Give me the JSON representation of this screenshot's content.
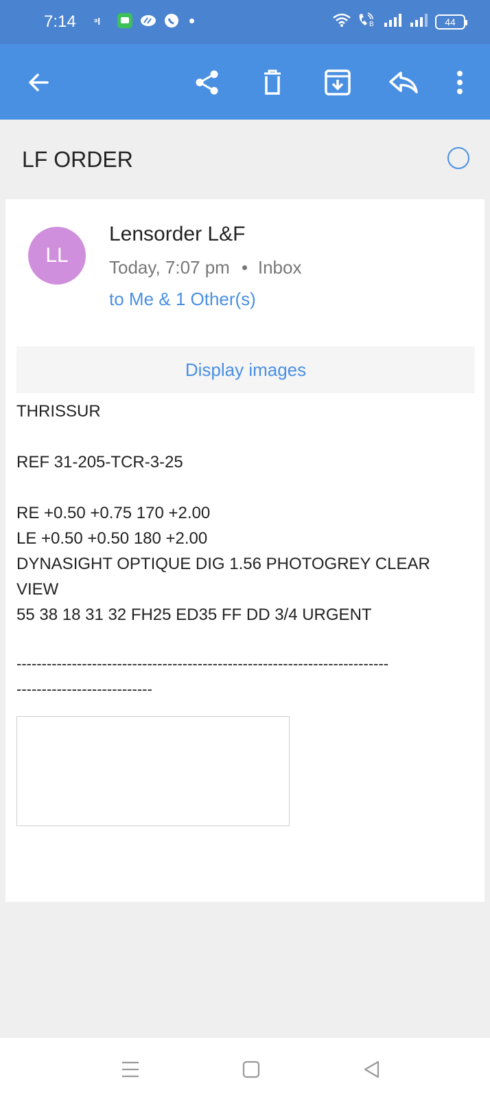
{
  "status_bar": {
    "time": "7:14",
    "battery": "44",
    "left_icons": [
      "signal-alert-icon",
      "message-app-icon",
      "loop-app-icon",
      "whatsapp-icon",
      "more-notifications-dot-icon"
    ],
    "right_icons": [
      "wifi-icon",
      "volte-call-icon",
      "signal-bars-1-icon",
      "signal-bars-2-icon",
      "battery-icon"
    ]
  },
  "toolbar": {
    "icons": [
      "back-arrow-icon",
      "share-icon",
      "delete-icon",
      "archive-icon",
      "reply-icon",
      "more-vert-icon"
    ]
  },
  "email": {
    "subject": "LF ORDER",
    "avatar_initials": "LL",
    "avatar_color": "#d08fdc",
    "sender": "Lensorder L&F",
    "date": "Today, 7:07 pm",
    "folder": "Inbox",
    "recipients": "to Me & 1 Other(s)",
    "display_images_label": "Display images",
    "body": {
      "line1": "THRISSUR",
      "line2": "REF 31-205-TCR-3-25",
      "line3": "RE +0.50 +0.75 170 +2.00",
      "line4": "LE +0.50 +0.50 180 +2.00",
      "line5": "DYNASIGHT OPTIQUE DIG 1.56 PHOTOGREY CLEAR",
      "line6": "VIEW",
      "line7": "55 38 18 31 32 FH25 ED35 FF DD 3/4 URGENT",
      "separator1": "--------------------------------------------------------------------------",
      "separator2": "---------------------------"
    }
  },
  "nav_bar": {
    "icons": [
      "recent-apps-icon",
      "home-icon",
      "back-triangle-icon"
    ]
  },
  "colors": {
    "status_bar": "#4a83cf",
    "app_bar": "#4a90e2",
    "accent": "#4a90e2"
  }
}
